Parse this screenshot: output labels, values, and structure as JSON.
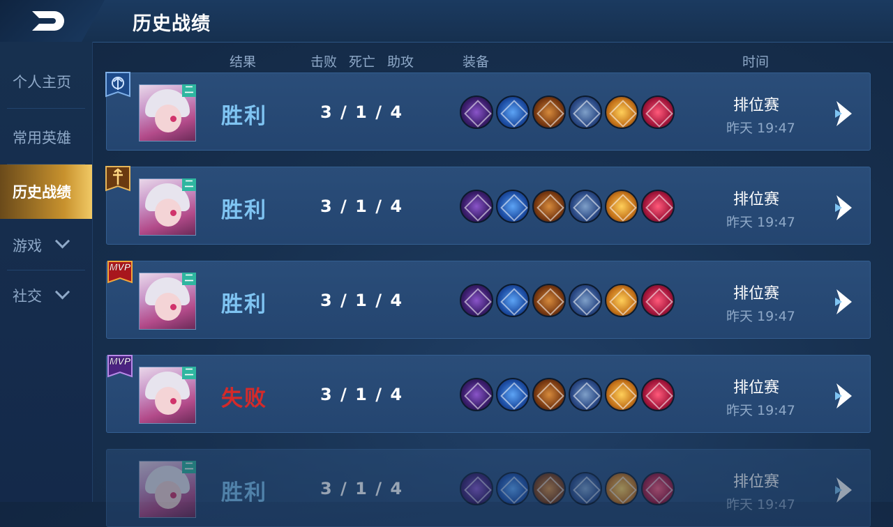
{
  "header": {
    "title": "历史战绩",
    "back_label": "back"
  },
  "sidebar": {
    "items": [
      {
        "label": "个人主页",
        "active": false,
        "expandable": false
      },
      {
        "label": "常用英雄",
        "active": false,
        "expandable": false
      },
      {
        "label": "历史战绩",
        "active": true,
        "expandable": false
      },
      {
        "label": "游戏",
        "active": false,
        "expandable": true
      },
      {
        "label": "社交",
        "active": false,
        "expandable": true
      }
    ]
  },
  "columns": {
    "result": "结果",
    "kills": "击败",
    "deaths": "死亡",
    "assists": "助攻",
    "equipment": "装备",
    "time": "时间"
  },
  "matches": [
    {
      "result": "胜利",
      "outcome": "win",
      "kda": "3 / 1 / 4",
      "mode": "排位赛",
      "time": "昨天 19:47",
      "badge": "rank-blue",
      "hero_tag": "二"
    },
    {
      "result": "胜利",
      "outcome": "win",
      "kda": "3 / 1 / 4",
      "mode": "排位赛",
      "time": "昨天 19:47",
      "badge": "rank-gold",
      "hero_tag": "二"
    },
    {
      "result": "胜利",
      "outcome": "win",
      "kda": "3 / 1 / 4",
      "mode": "排位赛",
      "time": "昨天 19:47",
      "badge": "mvp-red",
      "mvp_label": "MVP",
      "hero_tag": "二"
    },
    {
      "result": "失败",
      "outcome": "lose",
      "kda": "3 / 1 / 4",
      "mode": "排位赛",
      "time": "昨天 19:47",
      "badge": "mvp-purple",
      "mvp_label": "MVP",
      "hero_tag": "二"
    },
    {
      "result": "胜利",
      "outcome": "win",
      "kda": "3 / 1 / 4",
      "mode": "排位赛",
      "time": "昨天 19:47",
      "badge": "none",
      "hero_tag": "二"
    }
  ],
  "equipment_icons": [
    "axe-item-icon",
    "blue-blade-item-icon",
    "fire-sword-item-icon",
    "cross-shield-item-icon",
    "golden-wing-item-icon",
    "crimson-bow-item-icon"
  ],
  "colors": {
    "win": "#7fc4f2",
    "lose": "#d42a2a",
    "active_tab": "#c8922e",
    "background": "#17304f"
  }
}
